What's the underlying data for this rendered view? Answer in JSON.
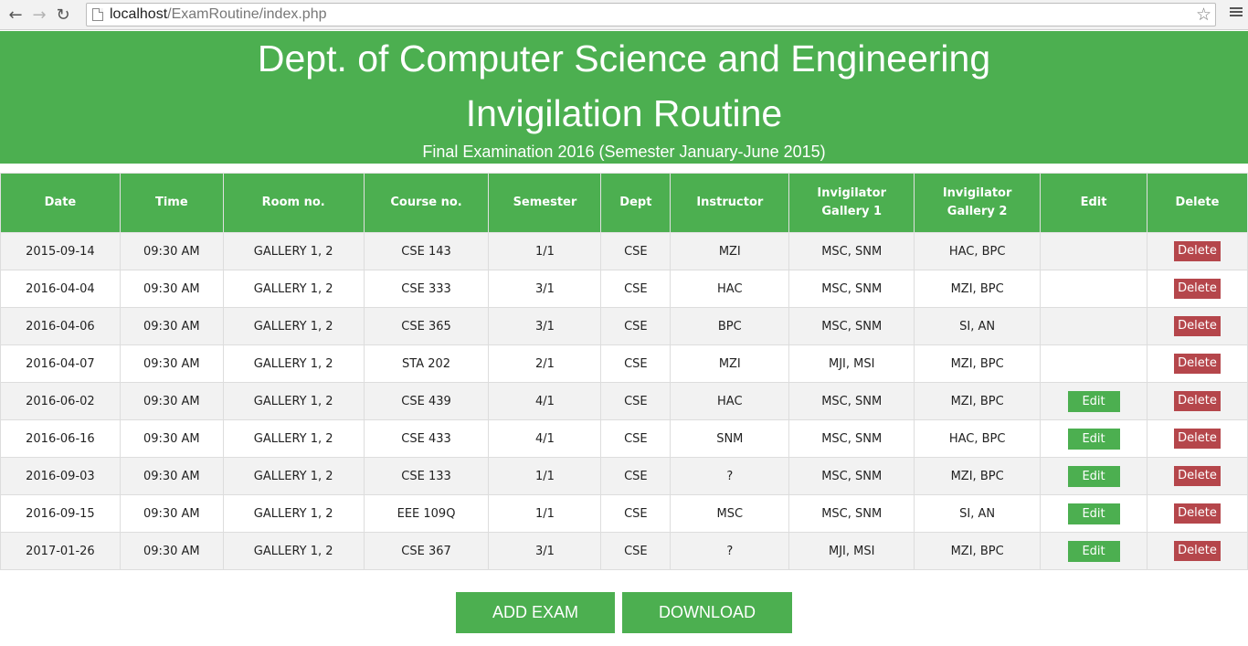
{
  "browser": {
    "url_host": "localhost",
    "url_path": "/ExamRoutine/index.php",
    "back_icon": "arrow-left-icon",
    "forward_icon": "arrow-right-icon",
    "reload_icon": "reload-icon"
  },
  "header": {
    "dept": "Dept. of Computer Science and Engineering",
    "title": "Invigilation Routine",
    "subtitle": "Final Examination 2016 (Semester January-June 2015)"
  },
  "table": {
    "headers": [
      "Date",
      "Time",
      "Room no.",
      "Course no.",
      "Semester",
      "Dept",
      "Instructor",
      "Invigilator Gallery 1",
      "Invigilator Gallery 2",
      "Edit",
      "Delete"
    ],
    "edit_label": "Edit",
    "delete_label": "Delete",
    "rows": [
      {
        "date": "2015-09-14",
        "time": "09:30 AM",
        "room": "GALLERY 1, 2",
        "course": "CSE 143",
        "semester": "1/1",
        "dept": "CSE",
        "instructor": "MZI",
        "inv1": "MSC, SNM",
        "inv2": "HAC, BPC",
        "editable": false
      },
      {
        "date": "2016-04-04",
        "time": "09:30 AM",
        "room": "GALLERY 1, 2",
        "course": "CSE 333",
        "semester": "3/1",
        "dept": "CSE",
        "instructor": "HAC",
        "inv1": "MSC, SNM",
        "inv2": "MZI, BPC",
        "editable": false
      },
      {
        "date": "2016-04-06",
        "time": "09:30 AM",
        "room": "GALLERY 1, 2",
        "course": "CSE 365",
        "semester": "3/1",
        "dept": "CSE",
        "instructor": "BPC",
        "inv1": "MSC, SNM",
        "inv2": "SI, AN",
        "editable": false
      },
      {
        "date": "2016-04-07",
        "time": "09:30 AM",
        "room": "GALLERY 1, 2",
        "course": "STA 202",
        "semester": "2/1",
        "dept": "CSE",
        "instructor": "MZI",
        "inv1": "MJI, MSI",
        "inv2": "MZI, BPC",
        "editable": false
      },
      {
        "date": "2016-06-02",
        "time": "09:30 AM",
        "room": "GALLERY 1, 2",
        "course": "CSE 439",
        "semester": "4/1",
        "dept": "CSE",
        "instructor": "HAC",
        "inv1": "MSC, SNM",
        "inv2": "MZI, BPC",
        "editable": true
      },
      {
        "date": "2016-06-16",
        "time": "09:30 AM",
        "room": "GALLERY 1, 2",
        "course": "CSE 433",
        "semester": "4/1",
        "dept": "CSE",
        "instructor": "SNM",
        "inv1": "MSC, SNM",
        "inv2": "HAC, BPC",
        "editable": true
      },
      {
        "date": "2016-09-03",
        "time": "09:30 AM",
        "room": "GALLERY 1, 2",
        "course": "CSE 133",
        "semester": "1/1",
        "dept": "CSE",
        "instructor": "?",
        "inv1": "MSC, SNM",
        "inv2": "MZI, BPC",
        "editable": true
      },
      {
        "date": "2016-09-15",
        "time": "09:30 AM",
        "room": "GALLERY 1, 2",
        "course": "EEE 109Q",
        "semester": "1/1",
        "dept": "CSE",
        "instructor": "MSC",
        "inv1": "MSC, SNM",
        "inv2": "SI, AN",
        "editable": true
      },
      {
        "date": "2017-01-26",
        "time": "09:30 AM",
        "room": "GALLERY 1, 2",
        "course": "CSE 367",
        "semester": "3/1",
        "dept": "CSE",
        "instructor": "?",
        "inv1": "MJI, MSI",
        "inv2": "MZI, BPC",
        "editable": true
      }
    ]
  },
  "actions": {
    "add_label": "ADD EXAM",
    "download_label": "DOWNLOAD"
  },
  "colors": {
    "primary": "#4caf50",
    "danger": "#b5464b",
    "row_alt": "#f2f2f2"
  }
}
